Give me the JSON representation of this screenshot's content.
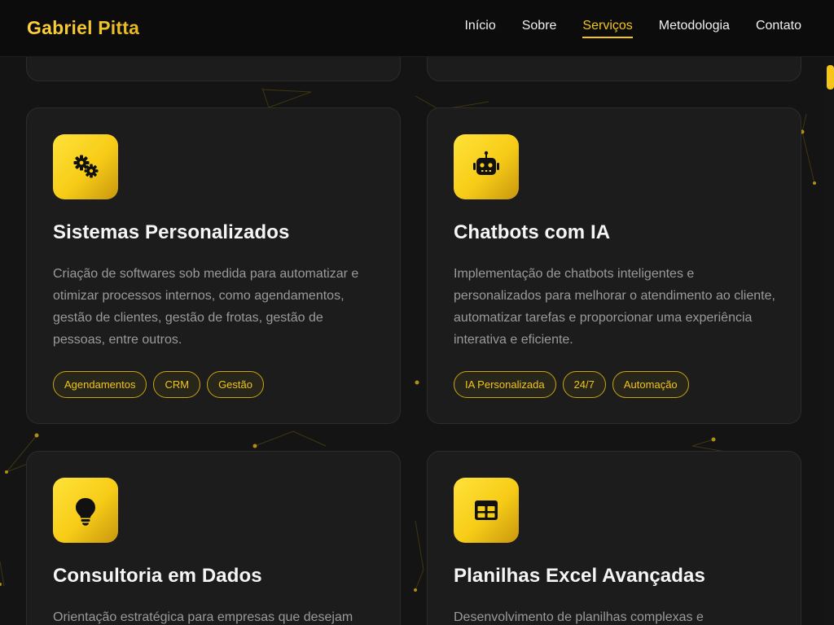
{
  "header": {
    "brand": "Gabriel Pitta",
    "nav": [
      {
        "label": "Início",
        "active": false
      },
      {
        "label": "Sobre",
        "active": false
      },
      {
        "label": "Serviços",
        "active": true
      },
      {
        "label": "Metodologia",
        "active": false
      },
      {
        "label": "Contato",
        "active": false
      }
    ]
  },
  "services": [
    {
      "icon": "gears-icon",
      "title": "Sistemas Personalizados",
      "description": "Criação de softwares sob medida para automatizar e otimizar processos internos, como agendamentos, gestão de clientes, gestão de frotas, gestão de pessoas, entre outros.",
      "tags": [
        "Agendamentos",
        "CRM",
        "Gestão"
      ]
    },
    {
      "icon": "robot-icon",
      "title": "Chatbots com IA",
      "description": "Implementação de chatbots inteligentes e personalizados para melhorar o atendimento ao cliente, automatizar tarefas e proporcionar uma experiência interativa e eficiente.",
      "tags": [
        "IA Personalizada",
        "24/7",
        "Automação"
      ]
    },
    {
      "icon": "lightbulb-icon",
      "title": "Consultoria em Dados",
      "description": "Orientação estratégica para empresas que desejam",
      "tags": []
    },
    {
      "icon": "table-icon",
      "title": "Planilhas Excel Avançadas",
      "description": "Desenvolvimento de planilhas complexas e",
      "tags": []
    }
  ],
  "colors": {
    "accent": "#f5c518",
    "background": "#141414",
    "card": "#1c1c1c"
  }
}
